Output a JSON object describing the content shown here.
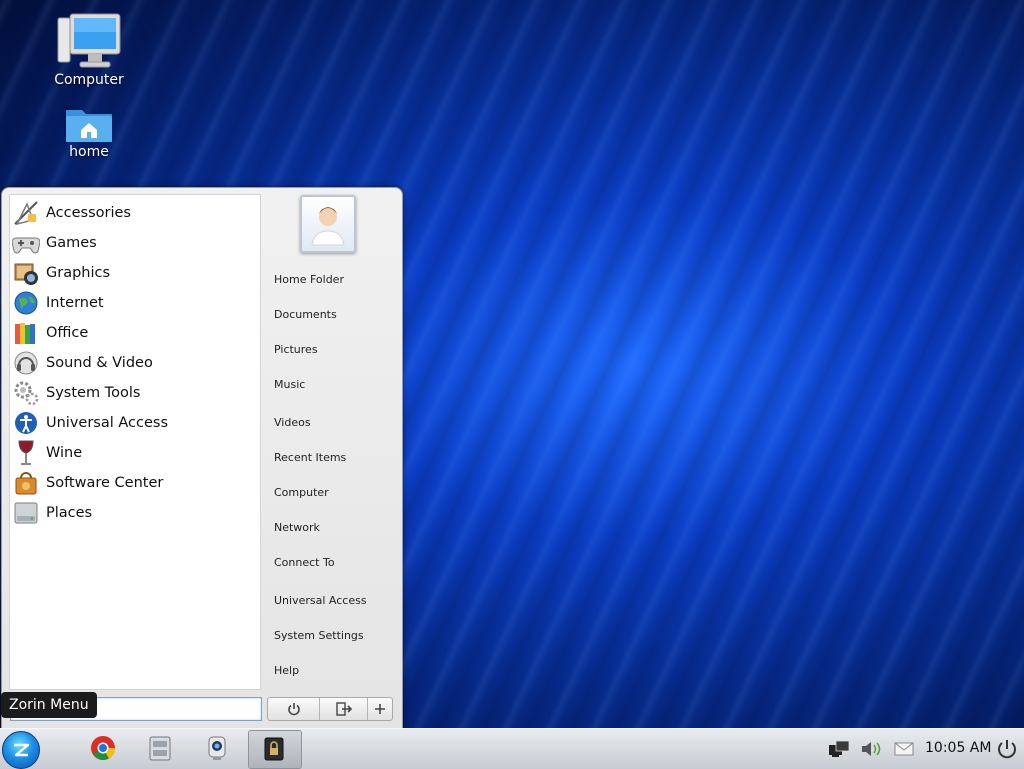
{
  "desktop": {
    "icons": [
      {
        "label": "Computer"
      },
      {
        "label": "home"
      }
    ]
  },
  "menu": {
    "categories": [
      {
        "label": "Accessories"
      },
      {
        "label": "Games"
      },
      {
        "label": "Graphics"
      },
      {
        "label": "Internet"
      },
      {
        "label": "Office"
      },
      {
        "label": "Sound & Video"
      },
      {
        "label": "System Tools"
      },
      {
        "label": "Universal Access"
      },
      {
        "label": "Wine"
      },
      {
        "label": "Software Center"
      },
      {
        "label": "Places"
      }
    ],
    "places": [
      {
        "label": "Home Folder"
      },
      {
        "label": "Documents"
      },
      {
        "label": "Pictures"
      },
      {
        "label": "Music"
      },
      {
        "label": "Videos"
      },
      {
        "label": "Recent Items"
      },
      {
        "label": "Computer"
      },
      {
        "label": "Network"
      },
      {
        "label": "Connect To"
      },
      {
        "label": "Universal Access"
      },
      {
        "label": "System Settings"
      },
      {
        "label": "Help"
      }
    ],
    "search": {
      "value": ""
    },
    "tooltip": "Zorin Menu",
    "buttons": [
      "power-icon",
      "logout-icon",
      "plus-icon"
    ]
  },
  "taskbar": {
    "apps": [
      "chrome-icon",
      "file-manager-icon",
      "webcam-icon",
      "lock-app-icon"
    ],
    "tray": [
      "network-icon",
      "volume-icon",
      "mail-icon",
      "power-icon"
    ],
    "clock": "10:05 AM"
  },
  "colors": {
    "accent": "#1d8fe6",
    "desktop_dark": "#031650",
    "desktop_bright": "#1f6bff"
  }
}
